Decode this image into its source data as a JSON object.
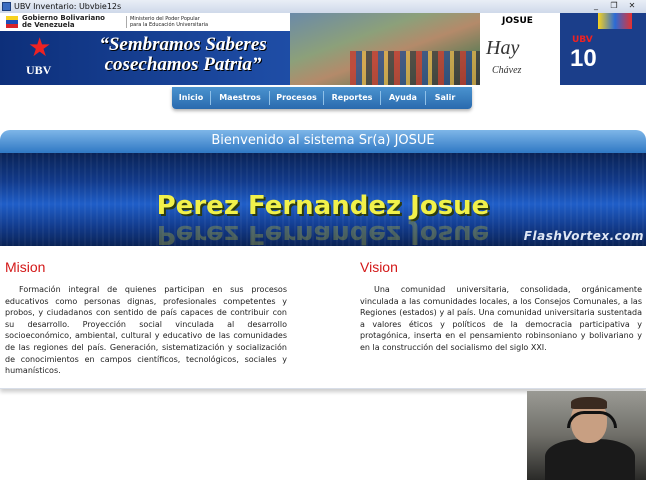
{
  "window": {
    "title": "UBV Inventario: Ubvbie12s",
    "controls": {
      "minimize": "_",
      "restore": "❐",
      "close": "✕"
    }
  },
  "banner": {
    "gov_name_line1": "Gobierno Bolivariano",
    "gov_name_line2": "de Venezuela",
    "ministry_line1": "Ministerio del Poder Popular",
    "ministry_line2": "para la Educación Universitaria",
    "logo_text": "UBV",
    "slogan_line1": "“Sembramos Saberes",
    "slogan_line2": "cosechamos Patria”",
    "user": "JOSUE",
    "signature": "Hay",
    "signature_name": "Chávez",
    "badge_small": "UBV",
    "badge_number": "10"
  },
  "nav": {
    "items": [
      "Inicio",
      "Maestros",
      "Procesos",
      "Reportes",
      "Ayuda",
      "Salir"
    ]
  },
  "welcome": {
    "text": "Bienvenido al sistema Sr(a) JOSUE"
  },
  "name_banner": {
    "name": "Perez Fernandez Josue",
    "watermark": "FlashVortex.com"
  },
  "mision": {
    "heading": "Mision",
    "text": "Formación integral de quienes participan en sus procesos educativos como personas dignas, profesionales competentes y probos, y ciudadanos con sentido de país capaces de contribuir con su desarrollo. Proyección social vinculada al desarrollo socioeconómico, ambiental, cultural y educativo de las comunidades de las regiones del país. Generación, sistematización y socialización de conocimientos en campos científicos, tecnológicos, sociales y humanísticos."
  },
  "vision": {
    "heading": "Vision",
    "text": "Una comunidad universitaria, consolidada, orgánicamente vinculada a las comunidades locales, a los Consejos Comunales, a las Regiones (estados) y al país. Una comunidad universitaria sustentada a valores éticos y políticos de la democracia participativa y protagónica, inserta en el pensamiento robinsoniano y bolivariano y en la construcción del socialismo del siglo XXI."
  },
  "colors": {
    "accent_red": "#d31818",
    "nav_blue": "#2a6aae",
    "name_yellow": "#f1f14a"
  }
}
